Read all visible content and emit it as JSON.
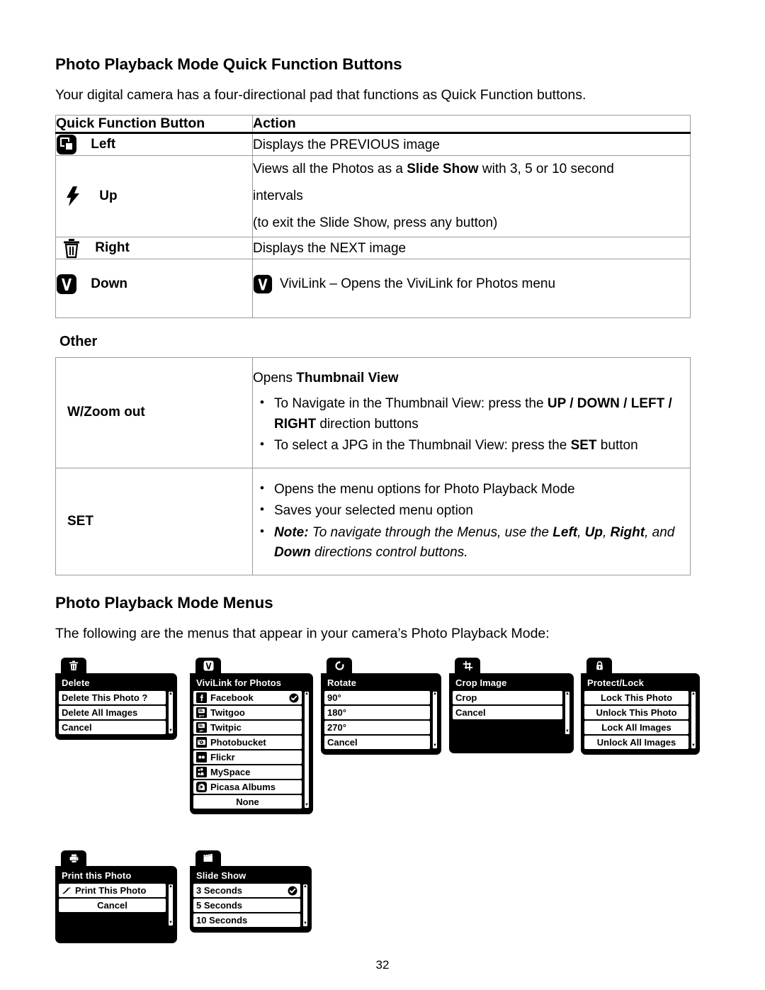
{
  "document": {
    "page_number": "32"
  },
  "section1": {
    "title": "Photo Playback Mode Quick Function Buttons",
    "intro": "Your digital camera has a four-directional pad that functions as Quick Function buttons.",
    "table": {
      "headers": [
        "Quick Function Button",
        "Action"
      ],
      "rows": [
        {
          "icon": "gallery-previous-icon",
          "button": "Left",
          "lines": [
            "Displays the PREVIOUS image"
          ]
        },
        {
          "icon": "flash-slideshow-icon",
          "button": "Up",
          "lines": [
            "Views all the Photos as a Slide Show with 3, 5 or 10 second",
            "intervals",
            "(to exit the Slide Show, press any button)"
          ],
          "line1_pre": "Views all the Photos as a ",
          "line1_bold": "Slide Show",
          "line1_post": " with 3, 5 or 10 second"
        },
        {
          "icon": "trash-delete-icon",
          "button": "Right",
          "lines": [
            "Displays the NEXT image"
          ]
        },
        {
          "icon": "vivilink-icon",
          "button": "Down",
          "action_icon": "vivilink-icon",
          "lines": [
            "ViviLink – Opens the ViviLink for Photos menu"
          ]
        }
      ]
    }
  },
  "other": {
    "heading": "Other",
    "rows": [
      {
        "button": "W/Zoom out",
        "headline_pre": "Opens ",
        "headline_bold": "Thumbnail View",
        "bullets": [
          {
            "parts": [
              {
                "t": "To Navigate in the Thumbnail View: press the ",
                "s": "n"
              },
              {
                "t": "UP / DOWN / LEFT / RIGHT",
                "s": "b"
              },
              {
                "t": " direction buttons",
                "s": "n"
              }
            ]
          },
          {
            "parts": [
              {
                "t": "To select a JPG in the Thumbnail View: press the ",
                "s": "n"
              },
              {
                "t": "SET",
                "s": "b"
              },
              {
                "t": " button",
                "s": "n"
              }
            ]
          }
        ]
      },
      {
        "button": "SET",
        "bullets": [
          {
            "parts": [
              {
                "t": "Opens the menu options for Photo Playback Mode",
                "s": "n"
              }
            ]
          },
          {
            "parts": [
              {
                "t": "Saves your selected menu option",
                "s": "n"
              }
            ]
          },
          {
            "parts": [
              {
                "t": "Note:",
                "s": "bi"
              },
              {
                "t": " To navigate through the Menus, use the ",
                "s": "i"
              },
              {
                "t": "Left",
                "s": "bi"
              },
              {
                "t": ", ",
                "s": "i"
              },
              {
                "t": "Up",
                "s": "bi"
              },
              {
                "t": ", ",
                "s": "i"
              },
              {
                "t": "Right",
                "s": "bi"
              },
              {
                "t": ", and ",
                "s": "i"
              },
              {
                "t": "Down",
                "s": "bi"
              },
              {
                "t": " directions control buttons.",
                "s": "i"
              }
            ]
          }
        ]
      }
    ]
  },
  "section2": {
    "title": "Photo Playback Mode Menus",
    "intro": "The following are the menus that appear in your camera’s Photo Playback Mode:"
  },
  "menus": [
    {
      "name": "delete",
      "tab_icon": "trash-icon",
      "title": "Delete",
      "items": [
        {
          "label": "Delete This Photo ?",
          "icon": null,
          "checked": false
        },
        {
          "label": "Delete All Images",
          "icon": null,
          "checked": false
        },
        {
          "label": "Cancel",
          "icon": null,
          "checked": false
        }
      ]
    },
    {
      "name": "vivilink-for-photos",
      "tab_icon": "vivilink-icon",
      "title": "ViviLink for Photos",
      "items": [
        {
          "label": "Facebook",
          "icon": "facebook-icon",
          "checked": true
        },
        {
          "label": "Twitgoo",
          "icon": "twitgoo-icon",
          "checked": false
        },
        {
          "label": "Twitpic",
          "icon": "twitpic-icon",
          "checked": false
        },
        {
          "label": "Photobucket",
          "icon": "photobucket-icon",
          "checked": false
        },
        {
          "label": "Flickr",
          "icon": "flickr-icon",
          "checked": false
        },
        {
          "label": "MySpace",
          "icon": "myspace-icon",
          "checked": false
        },
        {
          "label": "Picasa Albums",
          "icon": "picasa-icon",
          "checked": false
        },
        {
          "label": "None",
          "icon": null,
          "checked": false,
          "center": true
        }
      ]
    },
    {
      "name": "rotate",
      "tab_icon": "rotate-icon",
      "title": "Rotate",
      "items": [
        {
          "label": "90°",
          "icon": null,
          "checked": false
        },
        {
          "label": "180°",
          "icon": null,
          "checked": false
        },
        {
          "label": "270°",
          "icon": null,
          "checked": false
        },
        {
          "label": "Cancel",
          "icon": null,
          "checked": false
        }
      ]
    },
    {
      "name": "crop-image",
      "tab_icon": "crop-icon",
      "title": "Crop Image",
      "items": [
        {
          "label": "Crop",
          "icon": null,
          "checked": false
        },
        {
          "label": "Cancel",
          "icon": null,
          "checked": false
        }
      ]
    },
    {
      "name": "protect-lock",
      "tab_icon": "lock-icon",
      "title": "Protect/Lock",
      "items": [
        {
          "label": "Lock This Photo",
          "icon": null,
          "checked": false,
          "center": true
        },
        {
          "label": "Unlock This Photo",
          "icon": null,
          "checked": false,
          "center": true
        },
        {
          "label": "Lock All Images",
          "icon": null,
          "checked": false,
          "center": true
        },
        {
          "label": "Unlock All Images",
          "icon": null,
          "checked": false,
          "center": true
        }
      ]
    },
    {
      "name": "print-this-photo",
      "tab_icon": "printer-icon",
      "title": "Print this Photo",
      "items": [
        {
          "label": "Print This Photo",
          "icon": "print-mark-icon",
          "checked": false
        },
        {
          "label": "Cancel",
          "icon": null,
          "checked": false,
          "center": true
        }
      ]
    },
    {
      "name": "slide-show",
      "tab_icon": "clapper-icon",
      "title": "Slide Show",
      "items": [
        {
          "label": "3 Seconds",
          "icon": null,
          "checked": true
        },
        {
          "label": "5 Seconds",
          "icon": null,
          "checked": false
        },
        {
          "label": "10 Seconds",
          "icon": null,
          "checked": false
        }
      ]
    }
  ]
}
